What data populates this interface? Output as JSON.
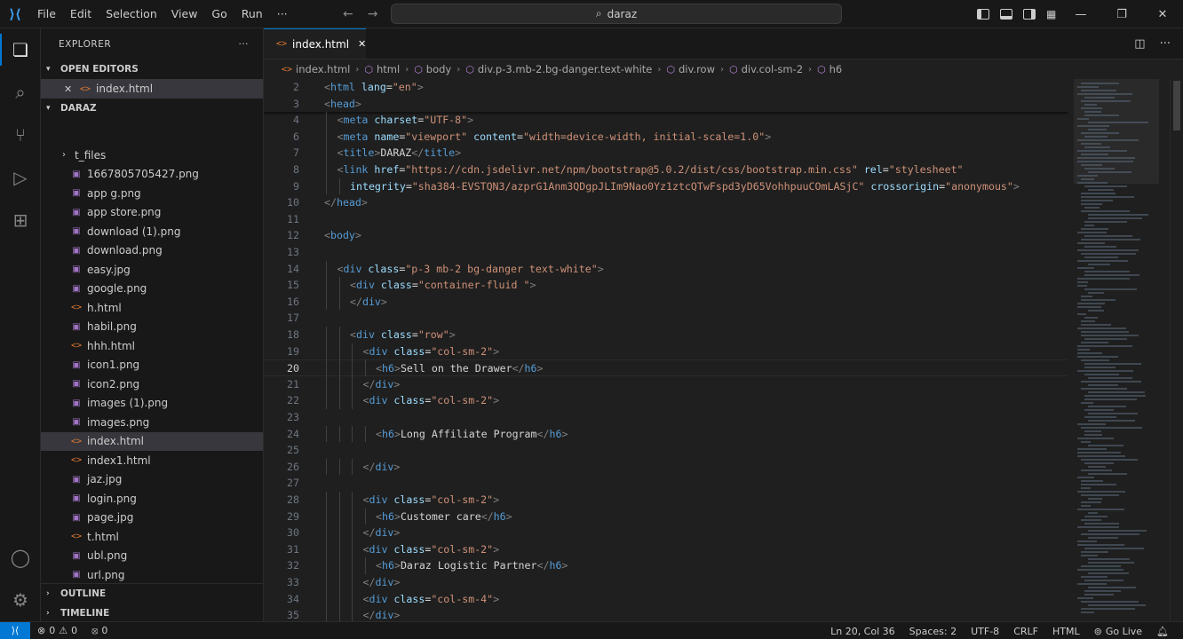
{
  "menu": [
    "File",
    "Edit",
    "Selection",
    "View",
    "Go",
    "Run",
    "···"
  ],
  "command_center": "daraz",
  "sidebar": {
    "title": "EXPLORER",
    "open_editors_label": "OPEN EDITORS",
    "open_editor_file": "index.html",
    "folder_label": "DARAZ",
    "files": [
      {
        "name": "t_files",
        "kind": "folder"
      },
      {
        "name": "1667805705427.png",
        "kind": "img"
      },
      {
        "name": "app g.png",
        "kind": "img"
      },
      {
        "name": "app store.png",
        "kind": "img"
      },
      {
        "name": "download (1).png",
        "kind": "img"
      },
      {
        "name": "download.png",
        "kind": "img"
      },
      {
        "name": "easy.jpg",
        "kind": "img"
      },
      {
        "name": "google.png",
        "kind": "img"
      },
      {
        "name": "h.html",
        "kind": "html"
      },
      {
        "name": "habil.png",
        "kind": "img"
      },
      {
        "name": "hhh.html",
        "kind": "html"
      },
      {
        "name": "icon1.png",
        "kind": "img"
      },
      {
        "name": "icon2.png",
        "kind": "img"
      },
      {
        "name": "images (1).png",
        "kind": "img"
      },
      {
        "name": "images.png",
        "kind": "img"
      },
      {
        "name": "index.html",
        "kind": "html",
        "selected": true
      },
      {
        "name": "index1.html",
        "kind": "html"
      },
      {
        "name": "jaz.jpg",
        "kind": "img"
      },
      {
        "name": "login.png",
        "kind": "img"
      },
      {
        "name": "page.jpg",
        "kind": "img"
      },
      {
        "name": "t.html",
        "kind": "html"
      },
      {
        "name": "ubl.png",
        "kind": "img"
      },
      {
        "name": "url.png",
        "kind": "img"
      }
    ],
    "outline_label": "OUTLINE",
    "timeline_label": "TIMELINE"
  },
  "editor": {
    "tab_label": "index.html",
    "breadcrumb": [
      "index.html",
      "html",
      "body",
      "div.p-3.mb-2.bg-danger.text-white",
      "div.row",
      "div.col-sm-2",
      "h6"
    ],
    "current_line": 20,
    "lines": [
      {
        "n": 2,
        "indent": 0,
        "html": "<span class='t'>&lt;</span><span class='tg'>html</span> <span class='at'>lang</span><span class='tx'>=</span><span class='st'>\"en\"</span><span class='t'>&gt;</span>"
      },
      {
        "n": 3,
        "indent": 0,
        "html": "<span class='t'>&lt;</span><span class='tg'>head</span><span class='t'>&gt;</span>"
      },
      {
        "n": 4,
        "indent": 1,
        "html": "<span class='t'>&lt;</span><span class='tg'>meta</span> <span class='at'>charset</span><span class='tx'>=</span><span class='st'>\"UTF-8\"</span><span class='t'>&gt;</span>"
      },
      {
        "n": 6,
        "indent": 1,
        "html": "<span class='t'>&lt;</span><span class='tg'>meta</span> <span class='at'>name</span><span class='tx'>=</span><span class='st'>\"viewport\"</span> <span class='at'>content</span><span class='tx'>=</span><span class='st'>\"width=device-width, initial-scale=1.0\"</span><span class='t'>&gt;</span>"
      },
      {
        "n": 7,
        "indent": 1,
        "html": "<span class='t'>&lt;</span><span class='tg'>title</span><span class='t'>&gt;</span><span class='tx'>DARAZ</span><span class='t'>&lt;/</span><span class='tg'>title</span><span class='t'>&gt;</span>"
      },
      {
        "n": 8,
        "indent": 1,
        "html": "<span class='t'>&lt;</span><span class='tg'>link</span> <span class='at'>href</span><span class='tx'>=</span><span class='st'>\"https://cdn.jsdelivr.net/npm/bootstrap@5.0.2/dist/css/bootstrap.min.css\"</span> <span class='at'>rel</span><span class='tx'>=</span><span class='st'>\"stylesheet\"</span>"
      },
      {
        "n": 9,
        "indent": 2,
        "html": "<span class='at'>integrity</span><span class='tx'>=</span><span class='st'>\"sha384-EVSTQN3/azprG1Anm3QDgpJLIm9Nao0Yz1ztcQTwFspd3yD65VohhpuuCOmLASjC\"</span> <span class='at'>crossorigin</span><span class='tx'>=</span><span class='st'>\"anonymous\"</span><span class='t'>&gt;</span>"
      },
      {
        "n": 10,
        "indent": 0,
        "html": "<span class='t'>&lt;/</span><span class='tg'>head</span><span class='t'>&gt;</span>"
      },
      {
        "n": 11,
        "indent": 0,
        "html": ""
      },
      {
        "n": 12,
        "indent": 0,
        "html": "<span class='t'>&lt;</span><span class='tg'>body</span><span class='t'>&gt;</span>"
      },
      {
        "n": 13,
        "indent": 0,
        "html": ""
      },
      {
        "n": 14,
        "indent": 1,
        "html": "<span class='t'>&lt;</span><span class='tg'>div</span> <span class='at'>class</span><span class='tx'>=</span><span class='st'>\"p-3 mb-2 bg-danger text-white\"</span><span class='t'>&gt;</span>"
      },
      {
        "n": 15,
        "indent": 2,
        "html": "<span class='t'>&lt;</span><span class='tg'>div</span> <span class='at'>class</span><span class='tx'>=</span><span class='st'>\"container-fluid \"</span><span class='t'>&gt;</span>"
      },
      {
        "n": 16,
        "indent": 2,
        "html": "<span class='t'>&lt;/</span><span class='tg'>div</span><span class='t'>&gt;</span>"
      },
      {
        "n": 17,
        "indent": 0,
        "html": ""
      },
      {
        "n": 18,
        "indent": 2,
        "html": "<span class='t'>&lt;</span><span class='tg'>div</span> <span class='at'>class</span><span class='tx'>=</span><span class='st'>\"row\"</span><span class='t'>&gt;</span>"
      },
      {
        "n": 19,
        "indent": 3,
        "html": "<span class='t'>&lt;</span><span class='tg'>div</span> <span class='at'>class</span><span class='tx'>=</span><span class='st'>\"col-sm-2\"</span><span class='t'>&gt;</span>"
      },
      {
        "n": 20,
        "indent": 4,
        "html": "<span class='t'>&lt;</span><span class='tg'>h6</span><span class='t'>&gt;</span><span class='tx'>Sell on the Drawer</span><span class='t'>&lt;/</span><span class='tg'>h6</span><span class='t'>&gt;</span>"
      },
      {
        "n": 21,
        "indent": 3,
        "html": "<span class='t'>&lt;/</span><span class='tg'>div</span><span class='t'>&gt;</span>"
      },
      {
        "n": 22,
        "indent": 3,
        "html": "<span class='t'>&lt;</span><span class='tg'>div</span> <span class='at'>class</span><span class='tx'>=</span><span class='st'>\"col-sm-2\"</span><span class='t'>&gt;</span>"
      },
      {
        "n": 23,
        "indent": 0,
        "html": ""
      },
      {
        "n": 24,
        "indent": 4,
        "html": "<span class='t'>&lt;</span><span class='tg'>h6</span><span class='t'>&gt;</span><span class='tx'>Long Affiliate Program</span><span class='t'>&lt;/</span><span class='tg'>h6</span><span class='t'>&gt;</span>"
      },
      {
        "n": 25,
        "indent": 0,
        "html": ""
      },
      {
        "n": 26,
        "indent": 3,
        "html": "<span class='t'>&lt;/</span><span class='tg'>div</span><span class='t'>&gt;</span>"
      },
      {
        "n": 27,
        "indent": 0,
        "html": ""
      },
      {
        "n": 28,
        "indent": 3,
        "html": "<span class='t'>&lt;</span><span class='tg'>div</span> <span class='at'>class</span><span class='tx'>=</span><span class='st'>\"col-sm-2\"</span><span class='t'>&gt;</span>"
      },
      {
        "n": 29,
        "indent": 4,
        "html": "<span class='t'>&lt;</span><span class='tg'>h6</span><span class='t'>&gt;</span><span class='tx'>Customer care</span><span class='t'>&lt;/</span><span class='tg'>h6</span><span class='t'>&gt;</span>"
      },
      {
        "n": 30,
        "indent": 3,
        "html": "<span class='t'>&lt;/</span><span class='tg'>div</span><span class='t'>&gt;</span>"
      },
      {
        "n": 31,
        "indent": 3,
        "html": "<span class='t'>&lt;</span><span class='tg'>div</span> <span class='at'>class</span><span class='tx'>=</span><span class='st'>\"col-sm-2\"</span><span class='t'>&gt;</span>"
      },
      {
        "n": 32,
        "indent": 4,
        "html": "<span class='t'>&lt;</span><span class='tg'>h6</span><span class='t'>&gt;</span><span class='tx'>Daraz Logistic Partner</span><span class='t'>&lt;/</span><span class='tg'>h6</span><span class='t'>&gt;</span>"
      },
      {
        "n": 33,
        "indent": 3,
        "html": "<span class='t'>&lt;/</span><span class='tg'>div</span><span class='t'>&gt;</span>"
      },
      {
        "n": 34,
        "indent": 3,
        "html": "<span class='t'>&lt;</span><span class='tg'>div</span> <span class='at'>class</span><span class='tx'>=</span><span class='st'>\"col-sm-4\"</span><span class='t'>&gt;</span>"
      },
      {
        "n": 35,
        "indent": 3,
        "html": "<span class='t'>&lt;/</span><span class='tg'>div</span><span class='t'>&gt;</span>"
      }
    ]
  },
  "status": {
    "errors": "0",
    "warnings": "0",
    "ports": "0",
    "position": "Ln 20, Col 36",
    "spaces": "Spaces: 2",
    "encoding": "UTF-8",
    "eol": "CRLF",
    "language": "HTML",
    "go_live": "Go Live"
  },
  "colors": {
    "accent": "#0078d4",
    "tag": "#569cd6",
    "attribute": "#9cdcfe",
    "string": "#ce9178"
  }
}
